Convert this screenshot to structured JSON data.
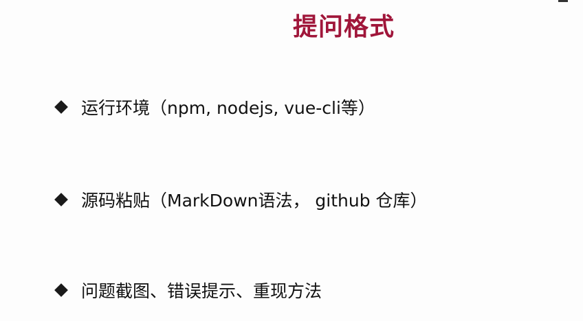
{
  "slide": {
    "title": "提问格式",
    "title_color": "#a0163a",
    "bullet_icon": "diamond-bullet-icon",
    "items": [
      {
        "label": "运行环境（npm, nodejs, vue-cli等）"
      },
      {
        "label": "源码粘贴（MarkDown语法， github 仓库）"
      },
      {
        "label": "问题截图、错误提示、重现方法"
      }
    ]
  }
}
